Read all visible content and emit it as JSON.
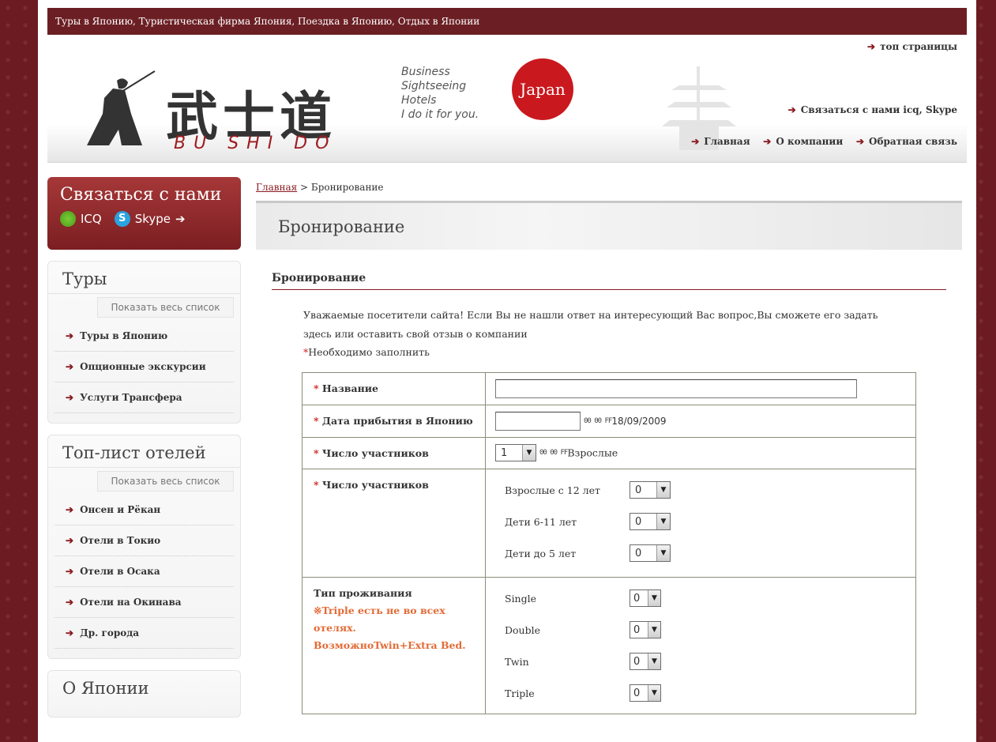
{
  "window": {
    "top_bar_text": "Туры в Японию, Туристическая фирма Япония, Поездка в Японию, Отдых в Японии"
  },
  "header": {
    "logo_kanji": "武士道",
    "logo_roman": "BU SHI DO",
    "tagline": [
      "Business",
      "Sightseeing",
      "Hotels",
      "I do it for you."
    ],
    "japan_badge": "Japan",
    "top_link": "топ страницы",
    "contact_link": "Связаться с нами icq, Skype",
    "nav": [
      "Главная",
      "О компании",
      "Обратная связь"
    ]
  },
  "sidebar": {
    "contact": {
      "title": "Связаться с нами",
      "icq": "ICQ",
      "skype": "Skype"
    },
    "tours": {
      "title": "Туры",
      "show_all": "Показать весь список",
      "items": [
        "Туры в Японию",
        "Опционные экскурсии",
        "Услуги Трансфера"
      ]
    },
    "hotels": {
      "title": "Топ-лист отелей",
      "show_all": "Показать весь список",
      "items": [
        "Онсен и Рёкан",
        "Отели в Токио",
        "Отели в Осака",
        "Отели на Окинава",
        "Др. города"
      ]
    },
    "about_title": "О Японии"
  },
  "main": {
    "breadcrumb_home": "Главная",
    "breadcrumb_current": "> Бронирование",
    "page_title": "Бронирование",
    "section_title": "Бронирование",
    "intro_line1": "Уважаемые посетители сайта! Если Вы не нашли ответ на интересующий Вас вопрос,Вы сможете его задать",
    "intro_line2": "здесь или оставить свой отзыв о компании",
    "required_note": "Необходимо заполнить",
    "required_star": "*"
  },
  "form": {
    "name_label": "Название",
    "arrival_label": "Дата прибытия в Японию",
    "arrival_hint": "18/09/2009",
    "participants_label": "Число участников",
    "participants_value": "1",
    "participants_suffix": "Взрослые",
    "participants2_label": "Число участников",
    "groups": [
      {
        "label": "Взрослые с 12 лет",
        "value": "0"
      },
      {
        "label": "Дети 6-11 лет",
        "value": "0"
      },
      {
        "label": "Дети до 5 лет",
        "value": "0"
      }
    ],
    "stay_label": "Тип проживания",
    "stay_note_1": "※Triple есть не во всех отелях.",
    "stay_note_2": "ВозможноTwin+Extra Bed.",
    "rooms": [
      {
        "label": "Single",
        "value": "0"
      },
      {
        "label": "Double",
        "value": "0"
      },
      {
        "label": "Twin",
        "value": "0"
      },
      {
        "label": "Triple",
        "value": "0"
      }
    ]
  },
  "icons": {
    "arrow": "➔",
    "dropdown": "▼",
    "garbled_glyphs": "00 00 FF"
  }
}
